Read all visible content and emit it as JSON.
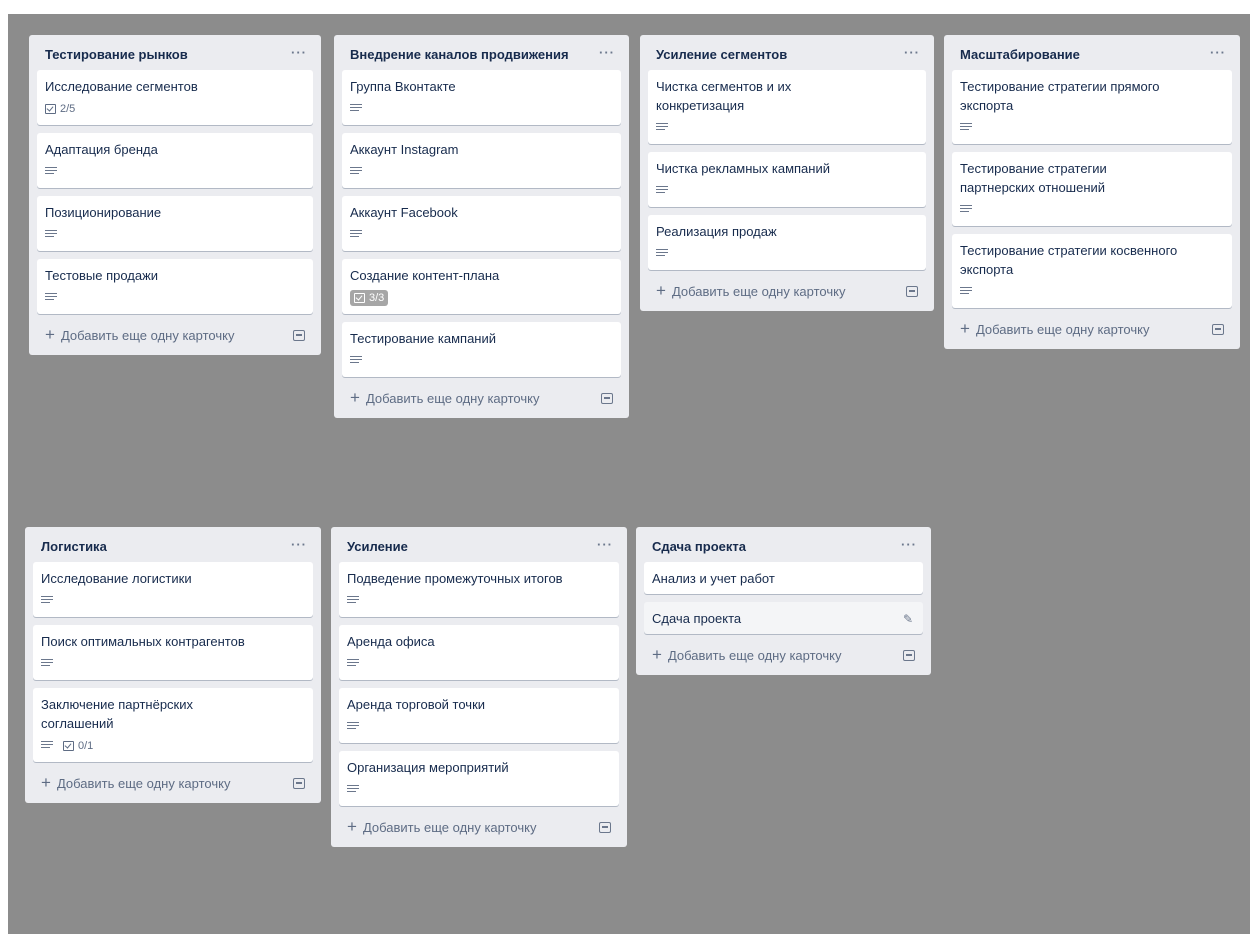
{
  "add_card_label": "Добавить еще одну карточку",
  "colors": {
    "board_bg": "#8c8c8c",
    "list_bg": "#ebecf0",
    "card_bg": "#ffffff",
    "badge_done": "#a6a6a6"
  },
  "icons": {
    "menu": "ellipsis-icon",
    "description": "description-icon",
    "checklist": "checklist-icon",
    "template": "card-template-icon",
    "edit": "pencil-icon",
    "add": "plus-icon"
  },
  "lists": [
    {
      "title": "Тестирование рынков",
      "menu": "···",
      "cards": [
        {
          "title": "Исследование сегментов",
          "checklist": "2/5"
        },
        {
          "title": "Адаптация бренда"
        },
        {
          "title": "Позиционирование"
        },
        {
          "title": "Тестовые продажи"
        }
      ]
    },
    {
      "title": "Внедрение каналов продвижения",
      "menu": "···",
      "cards": [
        {
          "title": "Группа Вконтакте"
        },
        {
          "title": "Аккаунт Instagram"
        },
        {
          "title": "Аккаунт Facebook"
        },
        {
          "title": "Создание контент-плана",
          "checklist": "3/3"
        },
        {
          "title": "Тестирование кампаний"
        }
      ]
    },
    {
      "title": "Усиление сегментов",
      "menu": "···",
      "cards": [
        {
          "title": "Чистка сегментов и их конкретизация"
        },
        {
          "title": "Чистка рекламных кампаний"
        },
        {
          "title": "Реализация продаж"
        }
      ]
    },
    {
      "title": "Масштабирование",
      "menu": "···",
      "cards": [
        {
          "title": "Тестирование стратегии прямого экспорта"
        },
        {
          "title": "Тестирование стратегии партнерских отношений"
        },
        {
          "title": "Тестирование стратегии косвенного экспорта"
        }
      ]
    },
    {
      "title": "Логистика",
      "menu": "···",
      "cards": [
        {
          "title": "Исследование логистики"
        },
        {
          "title": "Поиск оптимальных контрагентов"
        },
        {
          "title": "Заключение партнёрских соглашений",
          "checklist": "0/1"
        }
      ]
    },
    {
      "title": "Усиление",
      "menu": "···",
      "cards": [
        {
          "title": "Подведение промежуточных итогов"
        },
        {
          "title": "Аренда офиса"
        },
        {
          "title": "Аренда торговой точки"
        },
        {
          "title": "Организация мероприятий"
        }
      ]
    },
    {
      "title": "Сдача проекта",
      "menu": "···",
      "cards": [
        {
          "title": "Анализ и учет работ"
        },
        {
          "title": "Сдача проекта"
        }
      ]
    }
  ]
}
